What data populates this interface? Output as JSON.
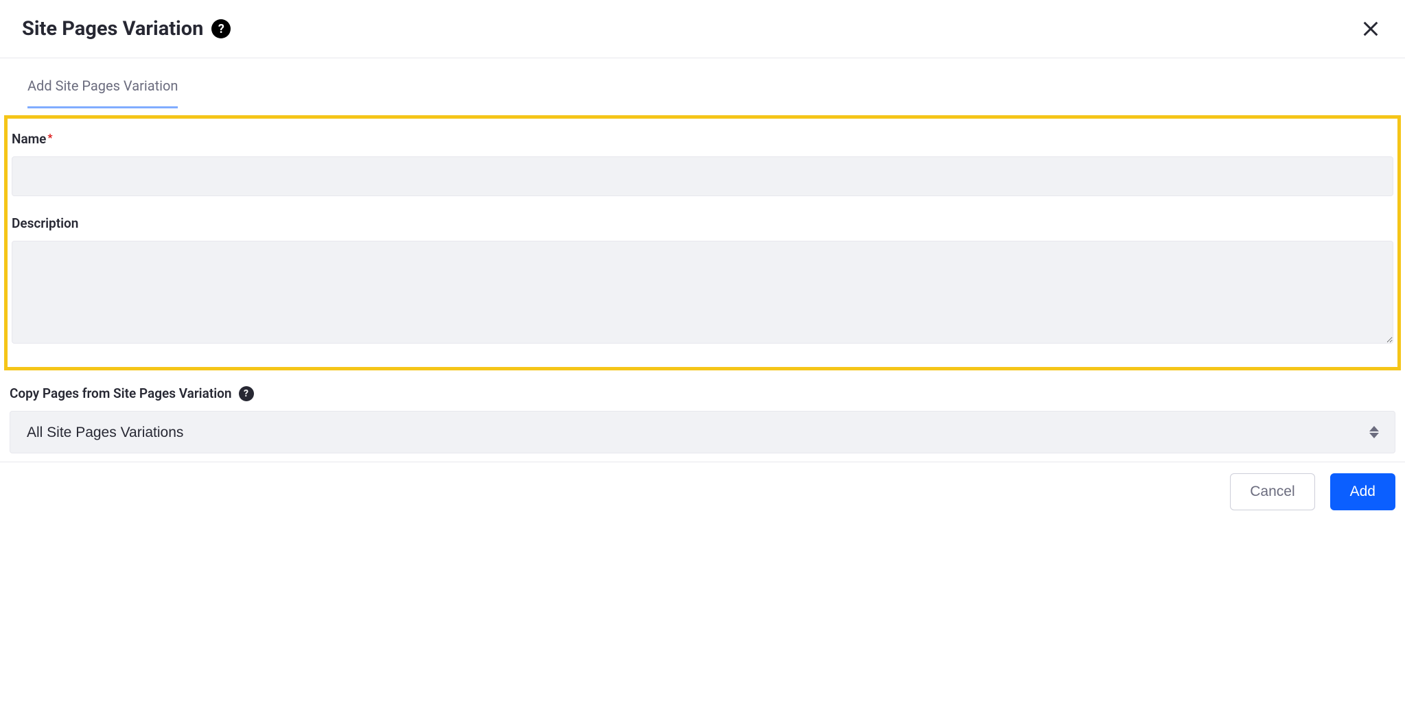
{
  "header": {
    "title": "Site Pages Variation"
  },
  "tabs": {
    "active": "Add Site Pages Variation"
  },
  "form": {
    "name_label": "Name",
    "name_value": "",
    "description_label": "Description",
    "description_value": ""
  },
  "copy_section": {
    "label": "Copy Pages from Site Pages Variation",
    "selected": "All Site Pages Variations"
  },
  "footer": {
    "cancel": "Cancel",
    "add": "Add"
  }
}
